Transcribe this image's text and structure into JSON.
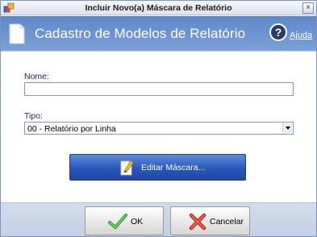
{
  "window": {
    "title": "Incluir Novo(a) Máscara de Relatório",
    "close_symbol": "×",
    "icon": "app-icon"
  },
  "header": {
    "title": "Cadastro de Modelos de Relatório",
    "icon": "document-icon",
    "help_symbol": "?",
    "help_label": "Ajuda"
  },
  "form": {
    "nome_label": "Nome:",
    "nome_value": "",
    "tipo_label": "Tipo:",
    "tipo_selected": "00 - Relatório por Linha"
  },
  "actions": {
    "edit_mask_label": "Editar Máscara...",
    "ok_label": "OK",
    "cancel_label": "Cancelar"
  },
  "colors": {
    "header_bg": "#6a92d0",
    "edit_button_bg": "#2a57b8",
    "label_text": "#1b1e7a",
    "footer_bg": "#c9d4e6"
  }
}
